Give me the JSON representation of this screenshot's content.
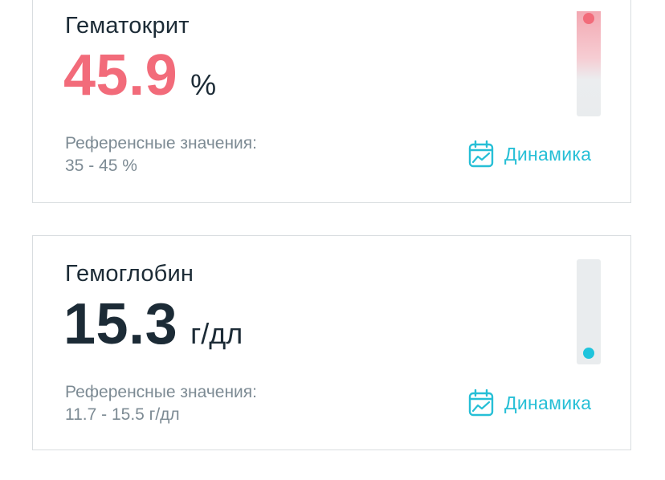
{
  "colors": {
    "high": "#f26b7a",
    "normal": "#1c2b36",
    "accent": "#26bfd6",
    "normal_dot": "#1fc4dc"
  },
  "cards": [
    {
      "title": "Гематокрит",
      "value": "45.9",
      "unit": "%",
      "status": "high",
      "ref_label": "Референсные значения:",
      "ref_range": "35 - 45 %",
      "dynamics_label": "Динамика",
      "dynamics_icon": "calendar-chart-icon",
      "indicator_level": "above-max"
    },
    {
      "title": "Гемоглобин",
      "value": "15.3",
      "unit": "г/дл",
      "status": "normal",
      "ref_label": "Референсные значения:",
      "ref_range": "11.7 - 15.5 г/дл",
      "dynamics_label": "Динамика",
      "dynamics_icon": "calendar-chart-icon",
      "indicator_level": "within-range"
    }
  ]
}
